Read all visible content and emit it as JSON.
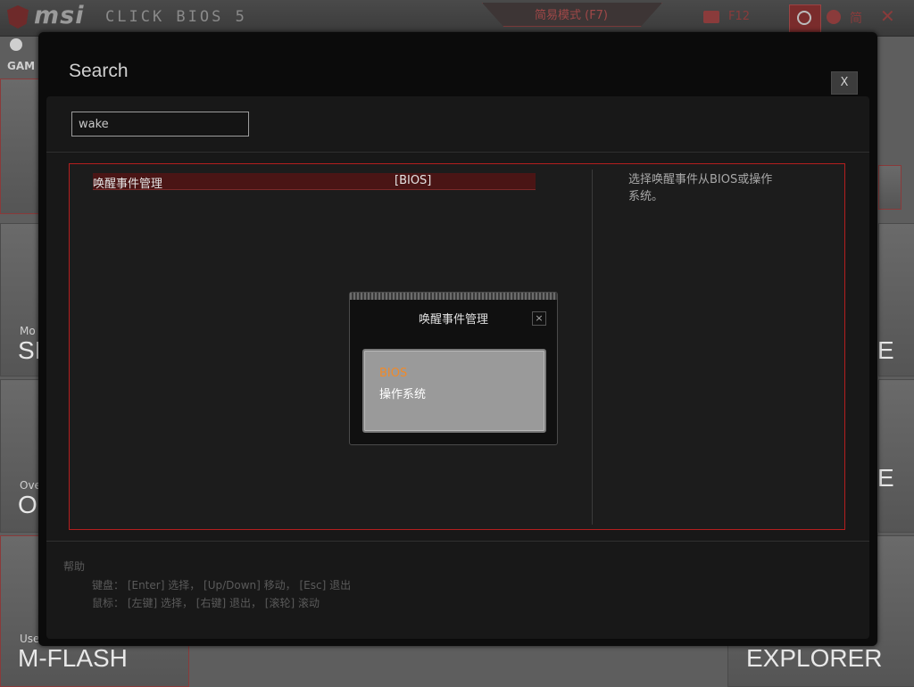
{
  "app": {
    "mode_label": "简易模式 (F7)",
    "f12_label": "F12",
    "language_label": "简",
    "logo_text": "msi",
    "logo_sub": "CLICK BIOS 5"
  },
  "background": {
    "game_label": "GAM",
    "tiles": [
      {
        "small": "Mo",
        "big": "SI"
      },
      {
        "small": "Ove",
        "big": "O"
      },
      {
        "small": "Use",
        "big": "M-FLASH"
      },
      {
        "big_right_1": "E",
        "big_right_2": "E",
        "big_right_3": "EXPLORER"
      }
    ]
  },
  "search": {
    "title": "Search",
    "close_label": "X",
    "query": "wake",
    "results": [
      {
        "name": "唤醒事件管理",
        "tag": "[BIOS]"
      }
    ],
    "description": "选择唤醒事件从BIOS或操作系统。",
    "help": {
      "title": "帮助",
      "keyboard": "键盘：  [Enter] 选择，  [Up/Down] 移动，  [Esc] 退出",
      "mouse": "鼠标：  [左键] 选择，  [右键] 退出，  [滚轮] 滚动"
    }
  },
  "popup": {
    "title": "唤醒事件管理",
    "close_label": "×",
    "options": [
      "BIOS",
      "操作系统"
    ],
    "selected": "BIOS"
  },
  "colors": {
    "accent_red": "#b41e1e",
    "selected_option": "#f08a2a",
    "result_highlight": "#4a1515"
  }
}
